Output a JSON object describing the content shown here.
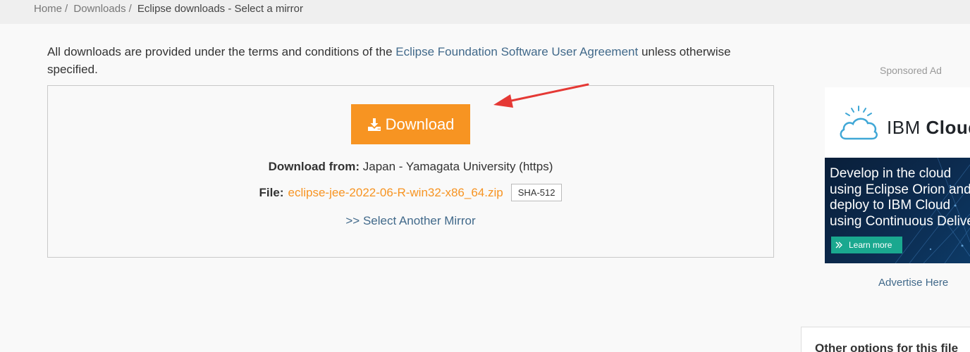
{
  "breadcrumb": {
    "items": [
      {
        "label": "Home"
      },
      {
        "label": "Downloads"
      }
    ],
    "separator": "/",
    "current": "Eclipse downloads - Select a mirror"
  },
  "terms": {
    "prefix": "All downloads are provided under the terms and conditions of the ",
    "link": "Eclipse Foundation Software User Agreement",
    "suffix": " unless otherwise specified."
  },
  "download": {
    "button_label": "Download",
    "from_label": "Download from:",
    "from_value": "Japan - Yamagata University (https)",
    "file_label": "File:",
    "file_name": "eclipse-jee-2022-06-R-win32-x86_64.zip",
    "checksum_label": "SHA-512",
    "another_mirror": ">> Select Another Mirror"
  },
  "sidebar": {
    "sponsored_label": "Sponsored Ad",
    "ad": {
      "brand_prefix": "IBM",
      "brand_suffix": "Cloud",
      "copy_lines": [
        "Develop in the cloud",
        "using Eclipse Orion and",
        "deploy to IBM Cloud",
        "using Continuous Delivery"
      ],
      "cta_label": "Learn more"
    },
    "advertise_label": "Advertise Here",
    "other_options_title": "Other options for this file"
  },
  "colors": {
    "accent_orange": "#f79422",
    "link_blue": "#41698a",
    "cta_teal": "#1aa88f",
    "annotation_red": "#e53935"
  }
}
